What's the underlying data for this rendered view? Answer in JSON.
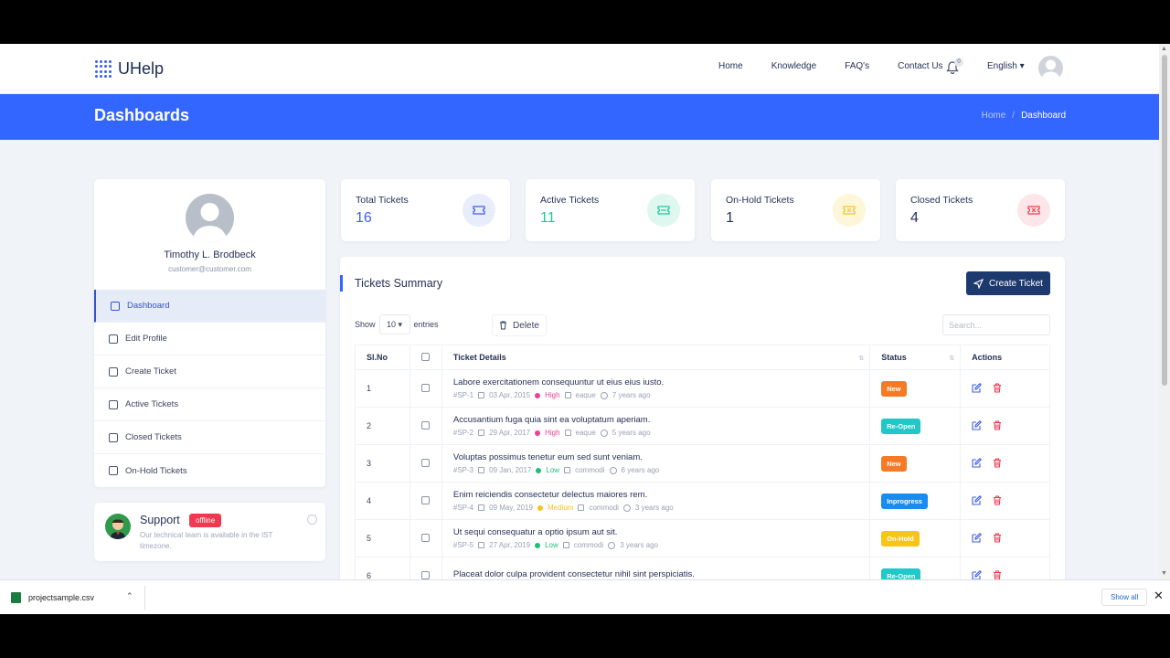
{
  "brand": {
    "name": "UHelp"
  },
  "nav": {
    "links": [
      "Home",
      "Knowledge",
      "FAQ's",
      "Contact Us"
    ],
    "notification_count": "0",
    "language": "English ▾"
  },
  "banner": {
    "title": "Dashboards",
    "breadcrumb": [
      "Home",
      "Dashboard"
    ]
  },
  "profile": {
    "name": "Timothy L. Brodbeck",
    "email": "customer@customer.com"
  },
  "sidebar": {
    "items": [
      {
        "label": "Dashboard",
        "icon": "grid-icon",
        "active": true
      },
      {
        "label": "Edit Profile",
        "icon": "user-edit-icon"
      },
      {
        "label": "Create Ticket",
        "icon": "ticket-add-icon"
      },
      {
        "label": "Active Tickets",
        "icon": "ticket-icon"
      },
      {
        "label": "Closed Tickets",
        "icon": "ticket-closed-icon"
      },
      {
        "label": "On-Hold Tickets",
        "icon": "ticket-hold-icon"
      }
    ]
  },
  "support": {
    "title": "Support",
    "status": "offline",
    "text": "Our technical team is available in the IST timezone."
  },
  "stats": [
    {
      "label": "Total Tickets",
      "value": "16",
      "color": "#3d5ee8",
      "bg": "#e8edfc"
    },
    {
      "label": "Active Tickets",
      "value": "11",
      "color": "#1fc99a",
      "bg": "#def7ef"
    },
    {
      "label": "On-Hold Tickets",
      "value": "1",
      "color": "#f5c518",
      "bg": "#fdf6d8"
    },
    {
      "label": "Closed Tickets",
      "value": "4",
      "color": "#f0384f",
      "bg": "#fde6ea"
    }
  ],
  "summary": {
    "title": "Tickets Summary",
    "create_label": "Create Ticket",
    "show_label": "Show",
    "entries_value": "10",
    "entries_label": "entries",
    "delete_label": "Delete",
    "search_placeholder": "Search...",
    "columns": [
      "Sl.No",
      "",
      "Ticket Details",
      "Status",
      "Actions"
    ],
    "rows": [
      {
        "no": "1",
        "title": "Labore exercitationem consequuntur ut eius eius iusto.",
        "id": "#SP-1",
        "date": "03 Apr, 2015",
        "priority": "High",
        "pcolor": "#e84393",
        "category": "eaque",
        "ago": "7 years ago",
        "status": "New",
        "scolor": "#f57a26"
      },
      {
        "no": "2",
        "title": "Accusantium fuga quia sint ea voluptatum aperiam.",
        "id": "#SP-2",
        "date": "29 Apr, 2017",
        "priority": "High",
        "pcolor": "#e84393",
        "category": "eaque",
        "ago": "5 years ago",
        "status": "Re-Open",
        "scolor": "#22c8c8"
      },
      {
        "no": "3",
        "title": "Voluptas possimus tenetur eum sed sunt veniam.",
        "id": "#SP-3",
        "date": "09 Jan, 2017",
        "priority": "Low",
        "pcolor": "#1fbf75",
        "category": "commodi",
        "ago": "6 years ago",
        "status": "New",
        "scolor": "#f57a26"
      },
      {
        "no": "4",
        "title": "Enim reiciendis consectetur delectus maiores rem.",
        "id": "#SP-4",
        "date": "09 May, 2019",
        "priority": "Medium",
        "pcolor": "#f5c518",
        "category": "commodi",
        "ago": "3 years ago",
        "status": "Inprogress",
        "scolor": "#1a8cf0"
      },
      {
        "no": "5",
        "title": "Ut sequi consequatur a optio ipsum aut sit.",
        "id": "#SP-5",
        "date": "27 Apr, 2019",
        "priority": "Low",
        "pcolor": "#1fbf75",
        "category": "commodi",
        "ago": "3 years ago",
        "status": "On-Hold",
        "scolor": "#f5c518"
      },
      {
        "no": "6",
        "title": "Placeat dolor culpa provident consectetur nihil sint perspiciatis.",
        "id": "",
        "date": "",
        "priority": "",
        "pcolor": "#1fbf75",
        "category": "",
        "ago": "",
        "status": "Re-Open",
        "scolor": "#22c8c8"
      }
    ]
  },
  "download": {
    "file": "projectsample.csv",
    "show_all": "Show all"
  }
}
